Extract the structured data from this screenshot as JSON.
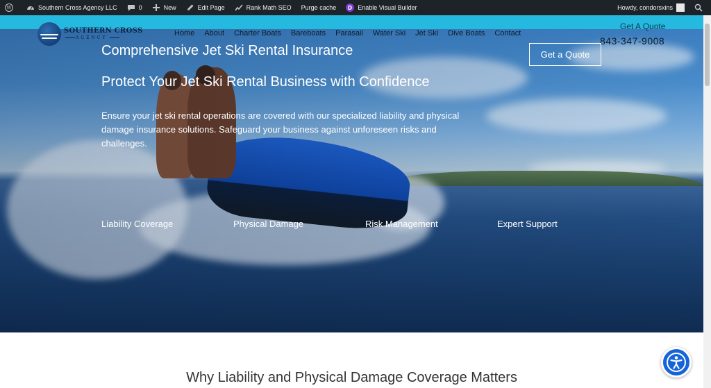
{
  "admin_bar": {
    "site_name": "Southern Cross Agency LLC",
    "comments_count": "0",
    "new_label": "New",
    "edit_label": "Edit Page",
    "rank_math_label": "Rank Math SEO",
    "purge_label": "Purge cache",
    "visual_builder_label": "Enable Visual Builder",
    "greeting": "Howdy, condorsxins"
  },
  "header": {
    "logo_name": "SOUTHERN CROSS",
    "logo_sub": "AGENCY",
    "nav": [
      "Home",
      "About",
      "Charter Boats",
      "Bareboats",
      "Parasail",
      "Water Ski",
      "Jet Ski",
      "Dive Boats",
      "Contact"
    ],
    "quote_link": "Get A Quote",
    "phone": "843-347-9008"
  },
  "hero": {
    "title": "Comprehensive Jet Ski Rental Insurance",
    "subtitle": "Protect Your Jet Ski Rental Business with Confidence",
    "text": "Ensure your jet ski rental operations are covered with our specialized liability and physical damage insurance solutions. Safeguard your business against unforeseen risks and challenges.",
    "button": "Get a Quote",
    "features": [
      "Liability Coverage",
      "Physical Damage",
      "Risk Management",
      "Expert Support"
    ]
  },
  "section": {
    "title": "Why Liability and Physical Damage Coverage Matters"
  },
  "colors": {
    "admin_bar": "#1d2327",
    "header_strip": "#25b9e0",
    "accessibility": "#1565d8"
  }
}
